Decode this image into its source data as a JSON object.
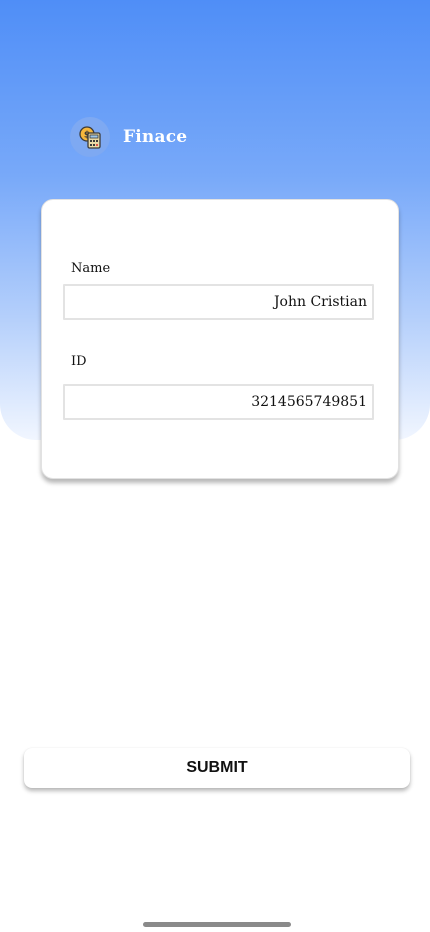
{
  "app": {
    "name": "Finace",
    "logo_icon": "calculator-coin-icon"
  },
  "form": {
    "name_label": "Name",
    "name_value": "John Cristian",
    "id_label": "ID",
    "id_value": "3214565749851"
  },
  "actions": {
    "submit_label": "SUBMIT"
  },
  "colors": {
    "header_gradient_top": "#4f8ef7",
    "header_gradient_bottom": "#f1f6ff",
    "brand_text": "#ffffff",
    "logo_circle": "#7ea9f2"
  }
}
